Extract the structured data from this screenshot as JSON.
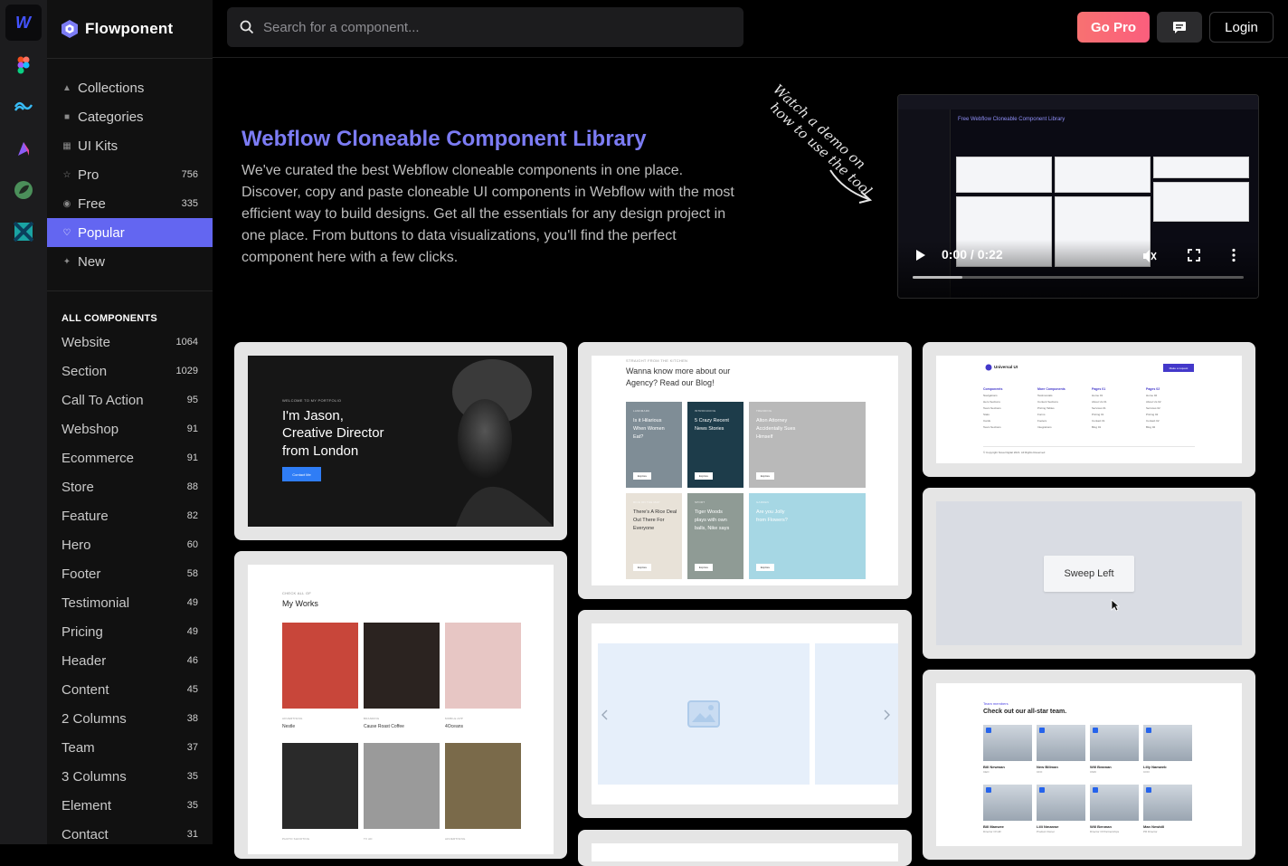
{
  "rail": {
    "items": [
      {
        "name": "webflow-icon"
      },
      {
        "name": "figma-icon"
      },
      {
        "name": "tailwind-icon"
      },
      {
        "name": "framer-icon"
      },
      {
        "name": "leaf-app-icon"
      },
      {
        "name": "grid-app-icon"
      }
    ]
  },
  "brand": {
    "name": "Flowponent"
  },
  "nav": {
    "items": [
      {
        "label": "Collections",
        "icon": "collections-icon",
        "count": ""
      },
      {
        "label": "Categories",
        "icon": "categories-icon",
        "count": ""
      },
      {
        "label": "UI Kits",
        "icon": "uikits-icon",
        "count": ""
      },
      {
        "label": "Pro",
        "icon": "star-icon",
        "count": "756"
      },
      {
        "label": "Free",
        "icon": "free-icon",
        "count": "335"
      },
      {
        "label": "Popular",
        "icon": "heart-icon",
        "count": ""
      },
      {
        "label": "New",
        "icon": "sparkle-icon",
        "count": ""
      }
    ],
    "active": "Popular"
  },
  "categories": {
    "title": "ALL COMPONENTS",
    "items": [
      {
        "label": "Website",
        "count": "1064"
      },
      {
        "label": "Section",
        "count": "1029"
      },
      {
        "label": "Call To Action",
        "count": "95"
      },
      {
        "label": "Webshop",
        "count": "91"
      },
      {
        "label": "Ecommerce",
        "count": "91"
      },
      {
        "label": "Store",
        "count": "88"
      },
      {
        "label": "Feature",
        "count": "82"
      },
      {
        "label": "Hero",
        "count": "60"
      },
      {
        "label": "Footer",
        "count": "58"
      },
      {
        "label": "Testimonial",
        "count": "49"
      },
      {
        "label": "Pricing",
        "count": "49"
      },
      {
        "label": "Header",
        "count": "46"
      },
      {
        "label": "Content",
        "count": "45"
      },
      {
        "label": "2 Columns",
        "count": "38"
      },
      {
        "label": "Team",
        "count": "37"
      },
      {
        "label": "3 Columns",
        "count": "35"
      },
      {
        "label": "Element",
        "count": "35"
      },
      {
        "label": "Contact",
        "count": "31"
      }
    ]
  },
  "topbar": {
    "search_placeholder": "Search for a component...",
    "go_pro": "Go Pro",
    "login": "Login"
  },
  "hero": {
    "title": "Webflow Cloneable Component Library",
    "description": "We've curated the best Webflow cloneable components in one place. Discover, copy and paste cloneable UI components in Webflow with the most efficient way to build designs. Get all the essentials for any design project in one place. From buttons to data visualizations, you'll find the perfect component here with a few clicks.",
    "handwritten_note": [
      "Watch a demo on",
      "how to use the tool"
    ]
  },
  "video": {
    "title": "Free Webflow Cloneable Component Library",
    "time": "0:00 / 0:22",
    "progress": 0.15
  },
  "cards": {
    "hero_jason": {
      "kicker": "WELCOME TO MY PORTFOLIO",
      "headline": [
        "I'm Jason,",
        "Creative Director",
        "from London"
      ],
      "button": "Contact Me"
    },
    "blog": {
      "kicker": "STRAIGHT FROM THE KITCHEN",
      "heading": [
        "Wanna know more about our",
        "Agency? Read our Blog!"
      ],
      "posts": [
        {
          "tag": "LANDMARK",
          "title": [
            "Is it Hilarious",
            "When Women",
            "Eat?"
          ],
          "btn": "Explore",
          "color": "#7f8d96"
        },
        {
          "tag": "INTRODUCING",
          "title": [
            "5 Crazy Recent",
            "News Stories"
          ],
          "btn": "Explore",
          "color": "#1d3c4a"
        },
        {
          "tag": "TRENDING",
          "title": [
            "Alton Attorney",
            "Accidentally Sues",
            "Himself"
          ],
          "btn": "Explore",
          "color": "#b9b9b9"
        },
        {
          "tag": "RICE ON THE MAP",
          "title": [
            "There's A Rice Deal",
            "Out There For",
            "Everyone"
          ],
          "btn": "Explore",
          "color": "#e8e2d8"
        },
        {
          "tag": "SPORT",
          "title": [
            "Tiger Woods",
            "plays with own",
            "balls, Nike says"
          ],
          "btn": "Explore",
          "color": "#8f9b95"
        },
        {
          "tag": "GARDEN",
          "title": [
            "Are you Jolly",
            "from Flowers?"
          ],
          "btn": "Explore",
          "color": "#a6d7e4"
        }
      ]
    },
    "footer": {
      "brand": "Universal UI",
      "cta": "Make a request",
      "columns": [
        {
          "title": "Components",
          "links": [
            "Navigations",
            "Hero Sections",
            "Team Sections",
            "Stats",
            "Cards",
            "Team Sections"
          ]
        },
        {
          "title": "More Components",
          "links": [
            "Testimonials",
            "Content Sections",
            "Pricing Tables",
            "Forms",
            "Footers",
            "Integrations"
          ]
        },
        {
          "title": "Pages 01",
          "links": [
            "Home 01",
            "About Us 01",
            "Services 01",
            "Pricing 01",
            "Contact 01",
            "Blog 01"
          ]
        },
        {
          "title": "Pages 02",
          "links": [
            "Home 02",
            "About Us 02",
            "Services 02",
            "Pricing 02",
            "Contact 02",
            "Blog 02"
          ]
        }
      ],
      "copyright": "© Copyright Nova Digital 2021. All Rights Reserved"
    },
    "sweep": {
      "button": "Sweep Left"
    },
    "works": {
      "kicker": "CHECK ALL OF",
      "title": "My Works",
      "items": [
        {
          "tag": "ADVERTISING",
          "name": "Nestle",
          "color": "#c8463a"
        },
        {
          "tag": "BRANDING",
          "name": "Cause Roast Coffee",
          "color": "#2b2320"
        },
        {
          "tag": "MOBILE APP",
          "name": "4Oceans",
          "color": "#e7c6c4"
        },
        {
          "tag": "PHOTO SHOOTING",
          "name": "",
          "color": "#2a2a2a"
        },
        {
          "tag": "TV AD",
          "name": "",
          "color": "#9a9a9a"
        },
        {
          "tag": "ADVERTISING",
          "name": "",
          "color": "#7a6a4a"
        }
      ]
    },
    "team": {
      "kicker": "Team members",
      "title": "Check out our all-star team.",
      "members": [
        {
          "name": "Bill Newman",
          "role": "CEO"
        },
        {
          "name": "New Billman",
          "role": "CFO"
        },
        {
          "name": "Will Beaman",
          "role": "CMO"
        },
        {
          "name": "Lilly Namweb",
          "role": "COO"
        },
        {
          "name": "Bill Manwee",
          "role": "Director Of HR"
        },
        {
          "name": "Lilli Nmanwe",
          "role": "Product Owner"
        },
        {
          "name": "Will Benman",
          "role": "Director Of Partnerships"
        },
        {
          "name": "Man Newbill",
          "role": "PR Director"
        }
      ]
    }
  },
  "colors": {
    "accent": "#6366f1",
    "go_pro": "#f87171",
    "hero_title": "#7c7cf5"
  }
}
